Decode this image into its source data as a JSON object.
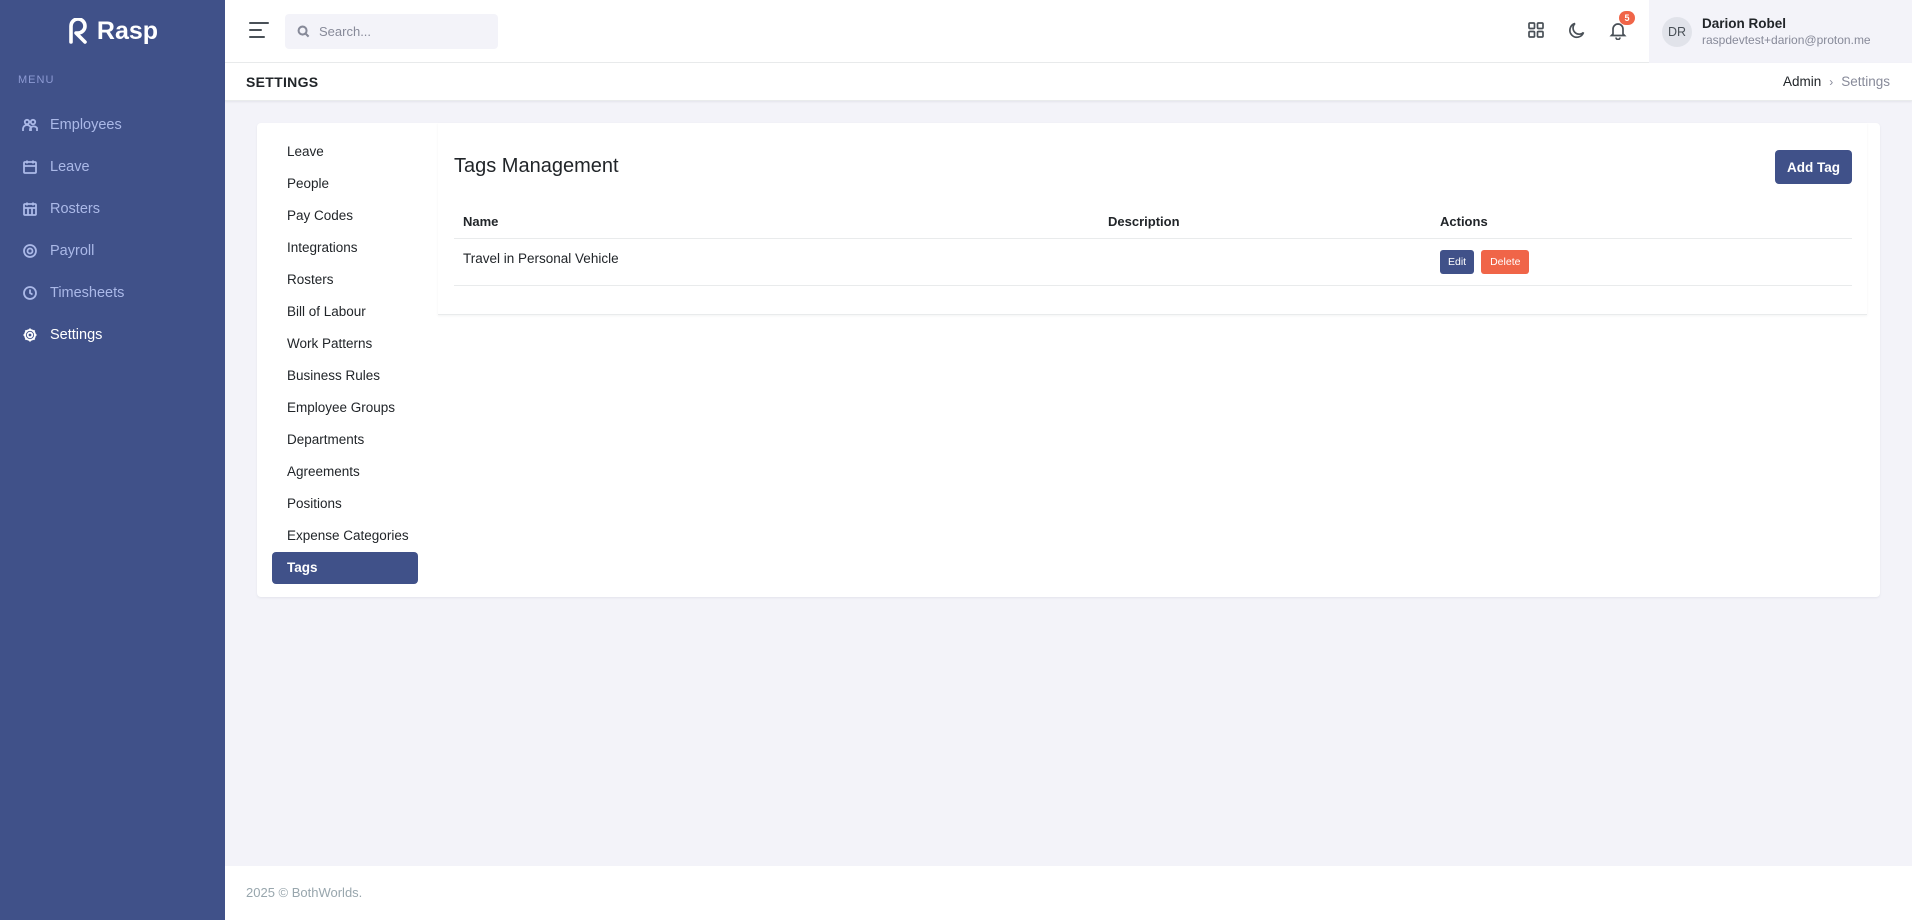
{
  "app": {
    "name": "Rasp"
  },
  "sidebar": {
    "menu_title": "MENU",
    "items": [
      {
        "label": "Employees",
        "icon": "users-icon"
      },
      {
        "label": "Leave",
        "icon": "calendar-icon"
      },
      {
        "label": "Rosters",
        "icon": "calendar-grid-icon"
      },
      {
        "label": "Payroll",
        "icon": "coin-icon"
      },
      {
        "label": "Timesheets",
        "icon": "clock-icon"
      },
      {
        "label": "Settings",
        "icon": "gear-icon",
        "active": true
      }
    ]
  },
  "topbar": {
    "search_placeholder": "Search...",
    "notifications_count": "5",
    "user": {
      "initials": "DR",
      "name": "Darion Robel",
      "email": "raspdevtest+darion@proton.me"
    }
  },
  "page": {
    "title": "SETTINGS",
    "breadcrumb": [
      "Admin",
      "Settings"
    ]
  },
  "settings_nav": [
    "Leave",
    "People",
    "Pay Codes",
    "Integrations",
    "Rosters",
    "Bill of Labour",
    "Work Patterns",
    "Business Rules",
    "Employee Groups",
    "Departments",
    "Agreements",
    "Positions",
    "Expense Categories",
    "Tags"
  ],
  "settings_nav_active": "Tags",
  "tags": {
    "title": "Tags Management",
    "add_label": "Add Tag",
    "columns": [
      "Name",
      "Description",
      "Actions"
    ],
    "rows": [
      {
        "name": "Travel in Personal Vehicle",
        "description": "",
        "edit_label": "Edit",
        "delete_label": "Delete"
      }
    ]
  },
  "footer": {
    "text": "2025 © BothWorlds."
  },
  "colors": {
    "primary": "#405189",
    "danger": "#f06548",
    "background": "#f3f3f9"
  }
}
